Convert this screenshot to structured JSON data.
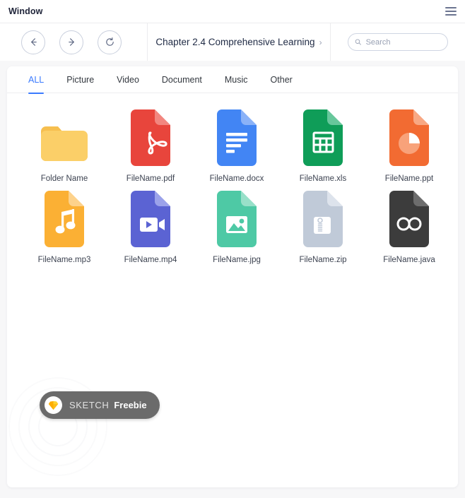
{
  "window": {
    "title": "Window",
    "menu_icon": "hamburger-icon"
  },
  "toolbar": {
    "back_icon": "arrow-left-icon",
    "forward_icon": "arrow-right-icon",
    "refresh_icon": "refresh-icon",
    "breadcrumb": "Chapter 2.4 Comprehensive Learning",
    "breadcrumb_chevron": "›",
    "search": {
      "icon": "search-icon",
      "placeholder": "Search",
      "value": ""
    }
  },
  "tabs": [
    {
      "label": "ALL",
      "active": true
    },
    {
      "label": "Picture",
      "active": false
    },
    {
      "label": "Video",
      "active": false
    },
    {
      "label": "Document",
      "active": false
    },
    {
      "label": "Music",
      "active": false
    },
    {
      "label": "Other",
      "active": false
    }
  ],
  "colors": {
    "accent": "#3a7afe",
    "folder": "#fbc85a",
    "pdf": "#e8453c",
    "docx": "#4285f4",
    "xls": "#0f9d58",
    "ppt": "#f26b32",
    "mp3": "#fbb034",
    "mp4": "#5b63d3",
    "jpg": "#4ec9a5",
    "zip": "#c0cad8",
    "java": "#3c3c3c"
  },
  "files": {
    "row1": [
      {
        "name": "Folder Name",
        "kind": "folder",
        "icon": "folder-icon"
      },
      {
        "name": "FileName.pdf",
        "kind": "pdf",
        "icon": "pdf-file-icon"
      },
      {
        "name": "FileName.docx",
        "kind": "docx",
        "icon": "docx-file-icon"
      },
      {
        "name": "FileName.xls",
        "kind": "xls",
        "icon": "xls-file-icon"
      },
      {
        "name": "FileName.ppt",
        "kind": "ppt",
        "icon": "ppt-file-icon"
      }
    ],
    "row2": [
      {
        "name": "FileName.mp3",
        "kind": "mp3",
        "icon": "mp3-file-icon"
      },
      {
        "name": "FileName.mp4",
        "kind": "mp4",
        "icon": "mp4-file-icon"
      },
      {
        "name": "FileName.jpg",
        "kind": "jpg",
        "icon": "jpg-file-icon"
      },
      {
        "name": "FileName.zip",
        "kind": "zip",
        "icon": "zip-file-icon"
      },
      {
        "name": "FileName.java",
        "kind": "java",
        "icon": "java-file-icon"
      }
    ]
  },
  "badge": {
    "logo_icon": "sketch-diamond-icon",
    "name": "SKETCH",
    "kind": "Freebie"
  }
}
